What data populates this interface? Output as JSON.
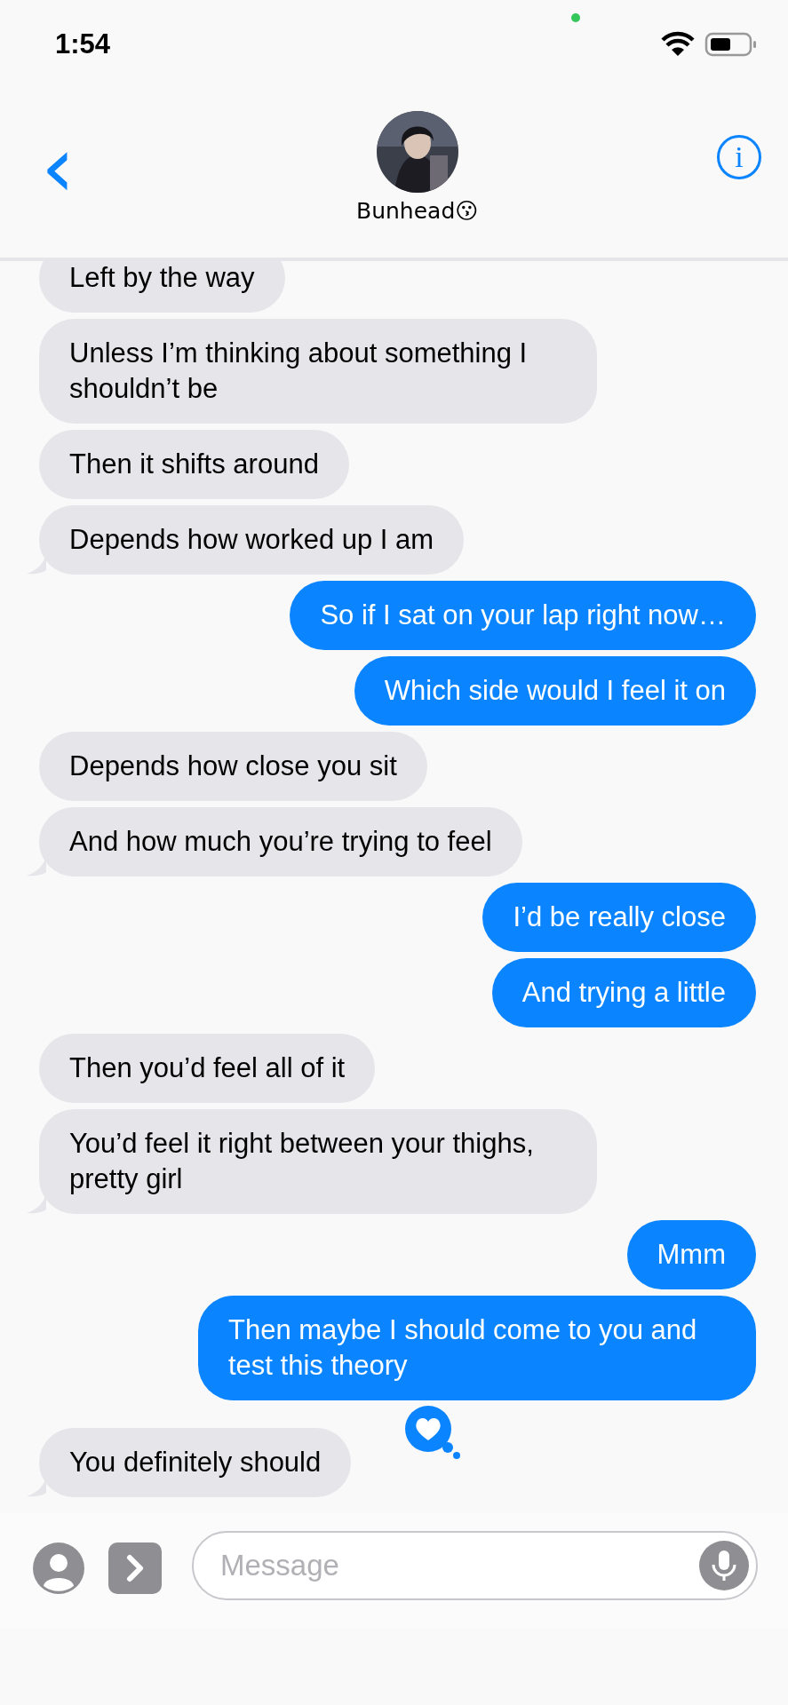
{
  "status_bar": {
    "time": "1:54"
  },
  "header": {
    "back": "‹",
    "contact_name": "Bunhead😗",
    "info": "i"
  },
  "messages": [
    {
      "kind": "received",
      "text": "Left by the way",
      "tail": false
    },
    {
      "kind": "received",
      "text": "Unless I’m thinking about something I shouldn’t be",
      "tail": false
    },
    {
      "kind": "received",
      "text": "Then it shifts around",
      "tail": false
    },
    {
      "kind": "received",
      "text": "Depends how worked up I am",
      "tail": true
    },
    {
      "kind": "sent",
      "text": "So if I sat on your lap right now…",
      "tail": false
    },
    {
      "kind": "sent",
      "text": "Which side would I feel it on",
      "tail": false
    },
    {
      "kind": "received",
      "text": "Depends how close you sit",
      "tail": false
    },
    {
      "kind": "received",
      "text": "And how much you’re trying to feel",
      "tail": true
    },
    {
      "kind": "sent",
      "text": "I’d be really close",
      "tail": false
    },
    {
      "kind": "sent",
      "text": "And trying a little",
      "tail": false
    },
    {
      "kind": "received",
      "text": "Then you’d feel all of it",
      "tail": false
    },
    {
      "kind": "received",
      "text": "You’d feel it right between your thighs, pretty girl",
      "tail": true
    },
    {
      "kind": "sent",
      "text": "Mmm",
      "tail": false
    },
    {
      "kind": "sent",
      "text": "Then maybe I should come to you and test this theory",
      "tail": false
    },
    {
      "kind": "received",
      "text": "You definitely should",
      "tail": true,
      "hearted": true
    }
  ],
  "composer": {
    "placeholder": "Message"
  }
}
